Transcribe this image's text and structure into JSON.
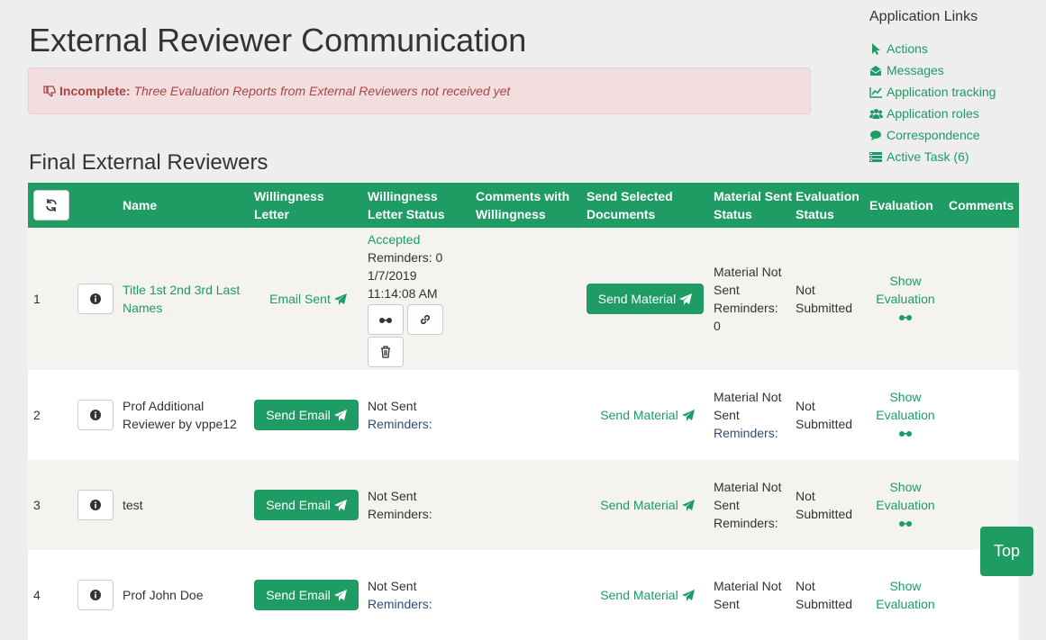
{
  "page": {
    "title": "External Reviewer Communication",
    "alert": {
      "label": "Incomplete:",
      "message": "Three Evaluation Reports from External Reviewers not received yet"
    },
    "section_title": "Final External Reviewers",
    "top_button": "Top"
  },
  "links": {
    "heading": "Application Links",
    "items": [
      {
        "label": "Actions",
        "icon": "pointer-icon"
      },
      {
        "label": "Messages",
        "icon": "envelope-open-icon"
      },
      {
        "label": "Application tracking",
        "icon": "line-chart-icon"
      },
      {
        "label": "Application roles",
        "icon": "users-icon"
      },
      {
        "label": "Correspondence",
        "icon": "comments-icon"
      },
      {
        "label": "Active Task (6)",
        "icon": "tasks-icon"
      }
    ]
  },
  "table": {
    "headers": {
      "name": "Name",
      "willingness_letter": "Willingness Letter",
      "willingness_status": "Willingness Letter Status",
      "comments_willingness": "Comments with Willingness",
      "send_docs": "Send Selected Documents",
      "material_status": "Material Sent Status",
      "evaluation_status": "Evaluation Status",
      "evaluation": "Evaluation",
      "comments": "Comments"
    },
    "rows": [
      {
        "index": "1",
        "name": "Title 1st 2nd 3rd Last Names",
        "letter": "Email Sent",
        "status_main": "Accepted",
        "status_lines": [
          "Reminders: 0",
          "1/7/2019",
          "11:14:08 AM"
        ],
        "send_docs": "Send Material",
        "material": [
          "Material Not",
          "Sent",
          "Reminders:",
          "0"
        ],
        "eval_status": [
          "Not",
          "Submitted"
        ],
        "evaluation": [
          "Show",
          "Evaluation"
        ]
      },
      {
        "index": "2",
        "name": "Prof Additional Reviewer by vppe12",
        "letter": "Send Email",
        "status_main": "Not Sent",
        "reminders": "Reminders:",
        "send_docs": "Send Material",
        "material": [
          "Material Not",
          "Sent",
          "Reminders:"
        ],
        "eval_status": [
          "Not",
          "Submitted"
        ],
        "evaluation": [
          "Show",
          "Evaluation"
        ]
      },
      {
        "index": "3",
        "name": "test",
        "letter": "Send Email",
        "status_main": "Not Sent",
        "reminders": "Reminders:",
        "send_docs": "Send Material",
        "material": [
          "Material Not",
          "Sent",
          "Reminders:"
        ],
        "eval_status": [
          "Not",
          "Submitted"
        ],
        "evaluation": [
          "Show",
          "Evaluation"
        ]
      },
      {
        "index": "4",
        "name": "Prof John Doe",
        "letter": "Send Email",
        "status_main": "Not Sent",
        "reminders": "Reminders:",
        "send_docs": "Send Material",
        "material": [
          "Material Not",
          "Sent"
        ],
        "eval_status": [
          "Not",
          "Submitted"
        ],
        "evaluation": [
          "Show",
          "Evaluation"
        ]
      }
    ]
  },
  "colors": {
    "accent": "#1f9b64",
    "link": "#1d9b64",
    "alert_text": "#a94442",
    "alert_bg": "#f2dede"
  }
}
